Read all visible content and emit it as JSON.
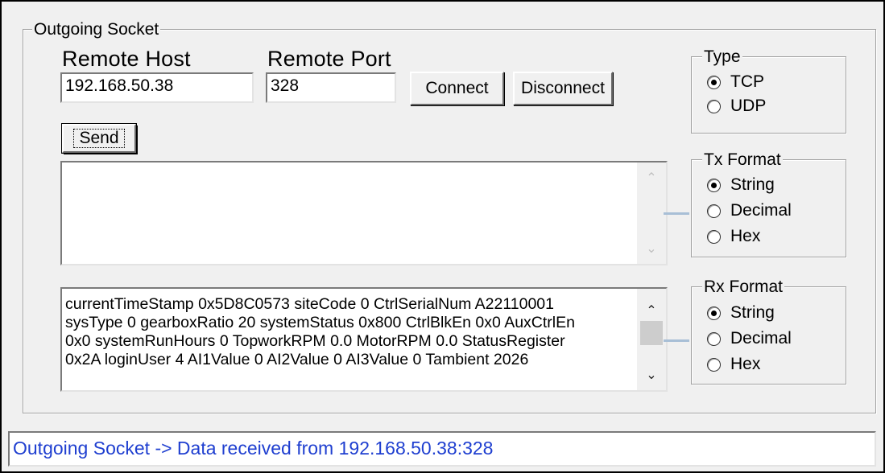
{
  "outgoing": {
    "group_title": "Outgoing Socket",
    "remote_host_label": "Remote Host",
    "remote_port_label": "Remote Port",
    "remote_host_value": "192.168.50.38",
    "remote_port_value": "328",
    "connect_label": "Connect",
    "disconnect_label": "Disconnect",
    "send_label": "Send",
    "tx_text": "",
    "rx_lines": [
      "currentTimeStamp 0x5D8C0573 siteCode 0 CtrlSerialNum A22110001",
      "sysType 0 gearboxRatio 20 systemStatus 0x800 CtrlBlkEn 0x0 AuxCtrlEn",
      "0x0 systemRunHours 0 TopworkRPM 0.0 MotorRPM 0.0 StatusRegister",
      "0x2A loginUser 4 AI1Value 0 AI2Value 0 AI3Value 0 Tambient 2026"
    ]
  },
  "type_group": {
    "title": "Type",
    "options": [
      "TCP",
      "UDP"
    ],
    "selected": "TCP"
  },
  "tx_format": {
    "title": "Tx Format",
    "options": [
      "String",
      "Decimal",
      "Hex"
    ],
    "selected": "String"
  },
  "rx_format": {
    "title": "Rx Format",
    "options": [
      "String",
      "Decimal",
      "Hex"
    ],
    "selected": "String"
  },
  "status_bar": {
    "text": "Outgoing Socket -> Data received from 192.168.50.38:328"
  },
  "icons": {
    "scroll_up": "chevron-up-icon",
    "scroll_down": "chevron-down-icon"
  },
  "colors": {
    "status_text": "#1f3fd0",
    "connector": "#a8bfd6"
  }
}
